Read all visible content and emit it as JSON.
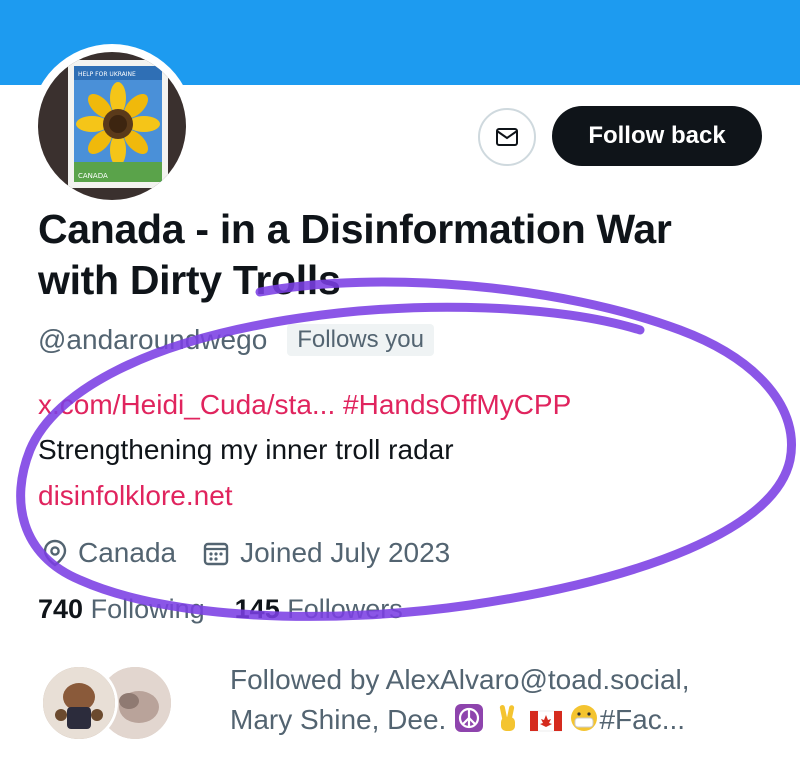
{
  "profile": {
    "display_name": "Canada - in a Disinformation War with Dirty Trolls",
    "handle": "@andaroundwego",
    "follows_you": "Follows you",
    "bio_link": "x.com/Heidi_Cuda/sta...",
    "bio_hashtag": "#HandsOffMyCPP",
    "bio_text": "Strengthening my inner troll radar",
    "website": "disinfolklore.net",
    "location": "Canada",
    "joined": "Joined July 2023",
    "following_count": "740",
    "following_label": "Following",
    "followers_count": "145",
    "followers_label": "Followers",
    "followed_by_prefix": "Followed by AlexAlvaro@toad.social,",
    "followed_by_line2": "Mary Shine, Dee.",
    "followed_by_suffix": "#Fac..."
  },
  "actions": {
    "follow_back_label": "Follow back",
    "message_icon": "mail-icon"
  },
  "avatar": {
    "stamp_text": "HELP FOR UKRAINE",
    "stamp_country": "CANADA"
  },
  "colors": {
    "banner": "#1d9bf0",
    "link": "#e0245e",
    "scribble": "#7b3fe4"
  }
}
